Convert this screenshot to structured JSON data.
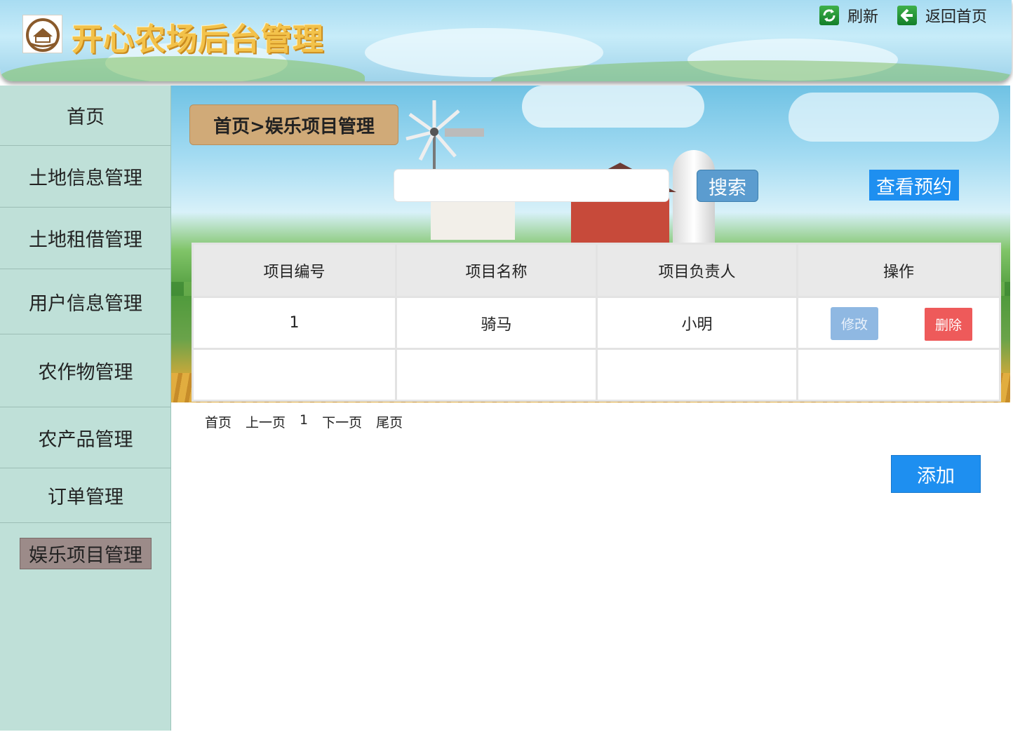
{
  "header": {
    "title": "开心农场后台管理",
    "logo_icon": "farm-logo-icon",
    "refresh_label": "刷新",
    "home_label": "返回首页"
  },
  "sidebar": {
    "items": [
      {
        "label": "首页"
      },
      {
        "label": "土地信息管理"
      },
      {
        "label": "土地租借管理"
      },
      {
        "label": "用户信息管理"
      },
      {
        "label": "农作物管理"
      },
      {
        "label": "农产品管理"
      },
      {
        "label": "订单管理"
      },
      {
        "label": "娱乐项目管理",
        "active": true
      }
    ]
  },
  "main": {
    "breadcrumb": "首页>娱乐项目管理",
    "search": {
      "value": "",
      "button_label": "搜索"
    },
    "reserve_label": "查看预约",
    "table": {
      "headers": [
        "项目编号",
        "项目名称",
        "项目负责人",
        "操作"
      ],
      "rows": [
        {
          "id": "1",
          "name": "骑马",
          "manager": "小明",
          "edit_label": "修改",
          "delete_label": "删除"
        }
      ]
    },
    "pager": {
      "first": "首页",
      "prev": "上一页",
      "current": "1",
      "next": "下一页",
      "last": "尾页"
    },
    "add_label": "添加"
  },
  "colors": {
    "sidebar_bg": "#bfe0d8",
    "active_item": "#9c8b89",
    "primary_button": "#1e8ff0",
    "delete_button": "#ee5a5a",
    "breadcrumb_bg": "#d0aa78"
  }
}
